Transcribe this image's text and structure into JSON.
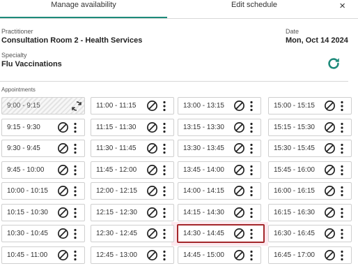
{
  "tabs": {
    "manage_availability": "Manage availability",
    "edit_schedule": "Edit schedule",
    "close": "×"
  },
  "details": {
    "practitioner_label": "Practitioner",
    "practitioner": "Consultation Room 2 - Health Services",
    "date_label": "Date",
    "date": "Mon, Oct 14 2024",
    "specialty_label": "Specialty",
    "specialty": "Flu Vaccinations"
  },
  "appointments": {
    "label": "Appointments",
    "columns": [
      [
        "9:00 - 9:15",
        "9:15 - 9:30",
        "9:30 - 9:45",
        "9:45 - 10:00",
        "10:00 - 10:15",
        "10:15 - 10:30",
        "10:30 - 10:45",
        "10:45 - 11:00"
      ],
      [
        "11:00 - 11:15",
        "11:15 - 11:30",
        "11:30 - 11:45",
        "11:45 - 12:00",
        "12:00 - 12:15",
        "12:15 - 12:30",
        "12:30 - 12:45",
        "12:45 - 13:00"
      ],
      [
        "13:00 - 13:15",
        "13:15 - 13:30",
        "13:30 - 13:45",
        "13:45 - 14:00",
        "14:00 - 14:15",
        "14:15 - 14:30",
        "14:30 - 14:45",
        "14:45 - 15:00"
      ],
      [
        "15:00 - 15:15",
        "15:15 - 15:30",
        "15:30 - 15:45",
        "15:45 - 16:00",
        "16:00 - 16:15",
        "16:15 - 16:30",
        "16:30 - 16:45",
        "16:45 - 17:00"
      ]
    ],
    "booked_slot": "9:00 - 9:15",
    "selected_slot": "14:30 - 14:45"
  },
  "colors": {
    "accent": "#1d8a7a",
    "selected_border": "#a3262a",
    "selected_highlight": "#fde8ee"
  },
  "icons": {
    "close": "close-icon",
    "refresh": "refresh-icon",
    "block": "block-icon",
    "more": "more-vertical-icon",
    "sync": "sync-icon"
  }
}
